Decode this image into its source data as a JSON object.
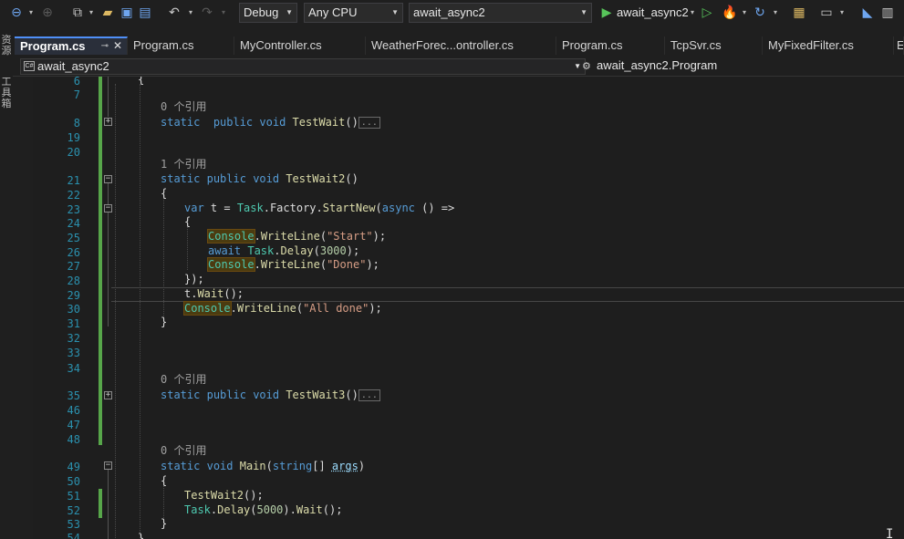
{
  "toolbar": {
    "config_value": "Debug",
    "platform_value": "Any CPU",
    "startup_project": "await_async2",
    "run_target": "await_async2",
    "icons": [
      "back-icon",
      "forward-icon",
      "new-item-icon",
      "open-folder-icon",
      "save-icon",
      "save-all-icon",
      "undo-icon",
      "redo-icon",
      "start-icon",
      "start-without-debug-icon",
      "hot-reload-icon",
      "restart-icon",
      "solution-explorer-icon",
      "layout-icon",
      "step-icon",
      "pin-icon"
    ]
  },
  "side_panel": {
    "label1": "资源",
    "label2": "工具箱"
  },
  "tabs": [
    {
      "label": "Program.cs",
      "active": true
    },
    {
      "label": "Program.cs",
      "active": false
    },
    {
      "label": "MyController.cs",
      "active": false
    },
    {
      "label": "WeatherForec...ontroller.cs",
      "active": false
    },
    {
      "label": "Program.cs",
      "active": false
    },
    {
      "label": "TcpSvr.cs",
      "active": false
    },
    {
      "label": "MyFixedFilter.cs",
      "active": false
    },
    {
      "label": "E",
      "active": false
    }
  ],
  "navbar": {
    "project": "await_async2",
    "class": "await_async2.Program"
  },
  "editor": {
    "refs": {
      "r0": "0 个引用",
      "r1": "1 个引用"
    },
    "collapsed_marker": "...",
    "line_numbers": [
      "6",
      "7",
      "8",
      "19",
      "20",
      "21",
      "22",
      "23",
      "24",
      "25",
      "26",
      "27",
      "28",
      "29",
      "30",
      "31",
      "32",
      "33",
      "34",
      "35",
      "46",
      "47",
      "48",
      "49",
      "50",
      "51",
      "52",
      "53",
      "54"
    ],
    "strings": {
      "start": "\"Start\"",
      "done": "\"Done\"",
      "all_done": "\"All done\""
    },
    "numbers": {
      "d1": "3000",
      "d2": "5000"
    },
    "methods": {
      "m1": "TestWait",
      "m2": "TestWait2",
      "m3": "TestWait3",
      "m4": "Main"
    }
  }
}
